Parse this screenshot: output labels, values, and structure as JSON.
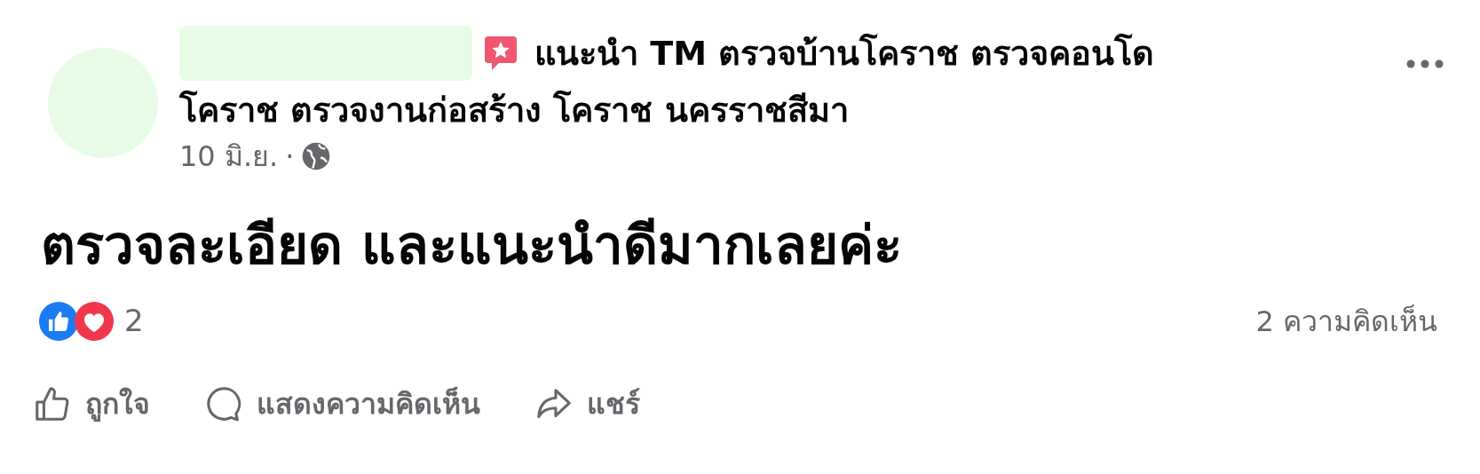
{
  "post": {
    "author_hidden": true,
    "recommends": true,
    "headline": [
      "แนะนำ TM ตรวจบ้านโคราช ตรวจคอนโด",
      "โคราช ตรวจงานก่อสร้าง โคราช นครราชสีมา"
    ],
    "date": "10 มิ.ย.",
    "separator": "·",
    "public": true,
    "body": "ตรวจละเอียด และแนะนำดีมากเลยค่ะ"
  },
  "reactions": {
    "count": "2",
    "comments": "2 ความคิดเห็น"
  },
  "actions": [
    {
      "kind": "like",
      "label": "ถูกใจ"
    },
    {
      "kind": "comment",
      "label": "แสดงความคิดเห็น"
    },
    {
      "kind": "share",
      "label": "แชร์"
    }
  ]
}
